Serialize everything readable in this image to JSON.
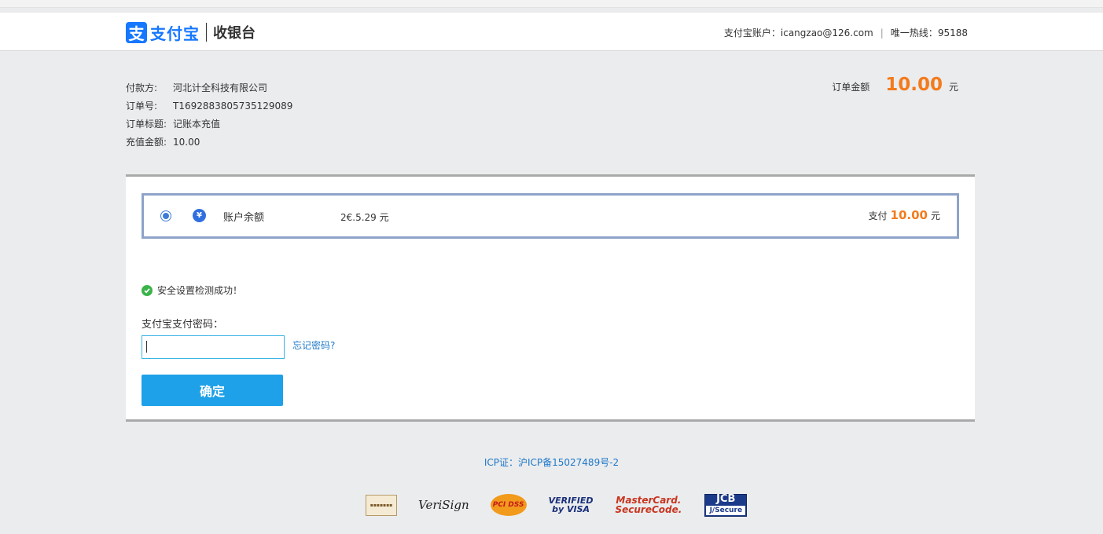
{
  "header": {
    "logo_mark": "支",
    "logo_text": "支付宝",
    "logo_sub": "收银台",
    "account_label": "支付宝账户：",
    "account_value": "icangzao@126.com",
    "hotline_label": "唯一热线：",
    "hotline_value": "95188"
  },
  "order": {
    "rows": [
      {
        "label": "付款方:",
        "value": "河北计全科技有限公司"
      },
      {
        "label": "订单号:",
        "value": "T1692883805735129089"
      },
      {
        "label": "订单标题:",
        "value": "记账本充值"
      },
      {
        "label": "充值金额:",
        "value": "10.00"
      }
    ],
    "amount_label": "订单金额",
    "amount_value": "10.00",
    "amount_unit": "元"
  },
  "payment_method": {
    "icon_glyph": "¥",
    "name": "账户余额",
    "balance": "2€.5.29 元",
    "pay_label": "支付",
    "pay_amount": "10.00",
    "pay_unit": "元"
  },
  "security": {
    "message": "安全设置检测成功！"
  },
  "password": {
    "label": "支付宝支付密码：",
    "value": "",
    "forgot_link": "忘记密码?",
    "confirm_label": "确定"
  },
  "footer": {
    "icp": "ICP证：沪ICP备15027489号-2",
    "badges": {
      "badge1": "▪▪▪▪▪▪▪",
      "verisign": "VeriSign",
      "pcidss": "PCI DSS",
      "visa_line1": "VERIFIED",
      "visa_line2": "by VISA",
      "mc_line1": "MasterCard.",
      "mc_line2": "SecureCode.",
      "jcb_line1": "JCB",
      "jcb_line2": "J/Secure"
    }
  }
}
